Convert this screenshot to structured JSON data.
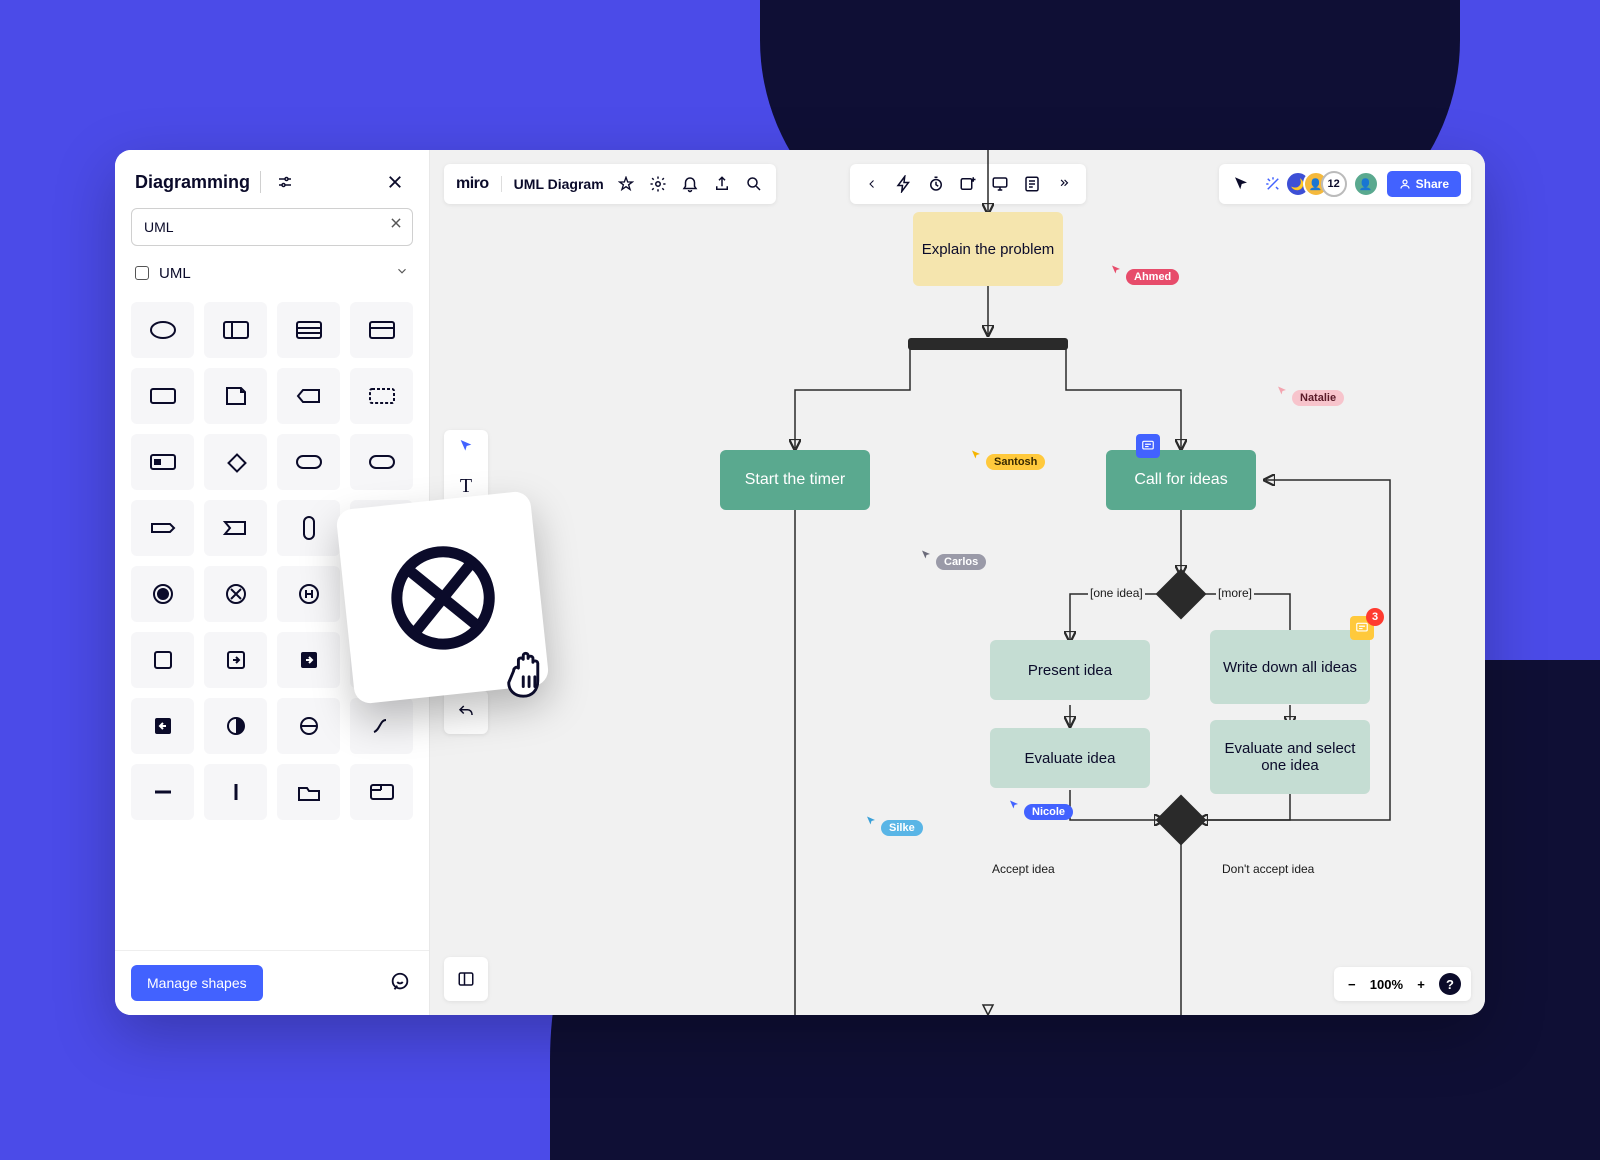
{
  "panel": {
    "title": "Diagramming",
    "search_value": "UML",
    "category_label": "UML",
    "manage_button": "Manage shapes",
    "shape_names": [
      "ellipse",
      "container",
      "multi-col",
      "card",
      "rectangle",
      "note",
      "tag-left",
      "dashed-rect",
      "frame",
      "diamond",
      "rounded-rect",
      "hex-card",
      "arrow-right",
      "arrow-shape",
      "pill-vert",
      "tall-rect",
      "filled-circle",
      "circle-x",
      "circle-h",
      "chevron-fill",
      "square",
      "square-arrow",
      "filled-arrow",
      "square-arrow-left",
      "filled-arrow-left",
      "half-circle",
      "half-empty",
      "curve",
      "minus",
      "pipe",
      "folder",
      "window"
    ]
  },
  "topbar": {
    "brand": "miro",
    "doc_title": "UML Diagram"
  },
  "collaborators": {
    "count": "12"
  },
  "share_label": "Share",
  "zoom": {
    "level": "100%"
  },
  "diagram": {
    "explain": "Explain the problem",
    "start_timer": "Start the timer",
    "call_ideas": "Call for ideas",
    "present": "Present idea",
    "write_down": "Write down all ideas",
    "evaluate": "Evaluate idea",
    "evaluate_select": "Evaluate and select one idea",
    "one_idea": "[one idea]",
    "more": "[more]",
    "accept": "Accept idea",
    "dont_accept": "Don't accept idea"
  },
  "cursors": {
    "ahmed": "Ahmed",
    "natalie": "Natalie",
    "santosh": "Santosh",
    "carlos": "Carlos",
    "nicole": "Nicole",
    "silke": "Silke"
  },
  "notification_count": "3"
}
